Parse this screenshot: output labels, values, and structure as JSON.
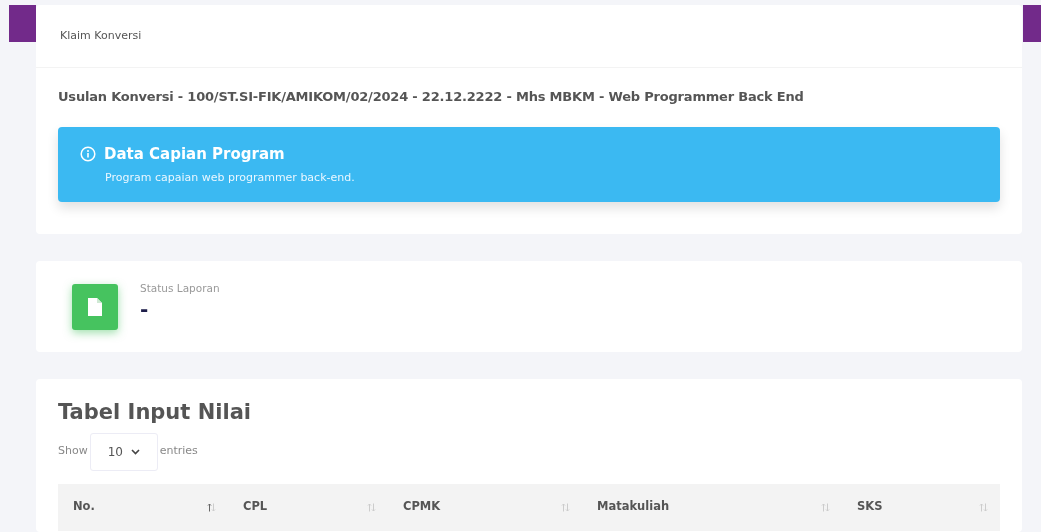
{
  "card_header": "Klaim Konversi",
  "proposal_title": "Usulan Konversi - 100/ST.SI-FIK/AMIKOM/02/2024 - 22.12.2222 - Mhs MBKM - Web Programmer Back End",
  "alert": {
    "title": "Data Capian Program",
    "text": "Program capaian web programmer back-end."
  },
  "status": {
    "label": "Status Laporan",
    "value": "-"
  },
  "table": {
    "title": "Tabel Input Nilai",
    "length_prefix": "Show",
    "length_value": "10",
    "length_suffix": "entries",
    "columns": [
      {
        "label": "No.",
        "sorted": true
      },
      {
        "label": "CPL",
        "sorted": false
      },
      {
        "label": "CPMK",
        "sorted": false
      },
      {
        "label": "Matakuliah",
        "sorted": false
      },
      {
        "label": "SKS",
        "sorted": false
      }
    ]
  }
}
